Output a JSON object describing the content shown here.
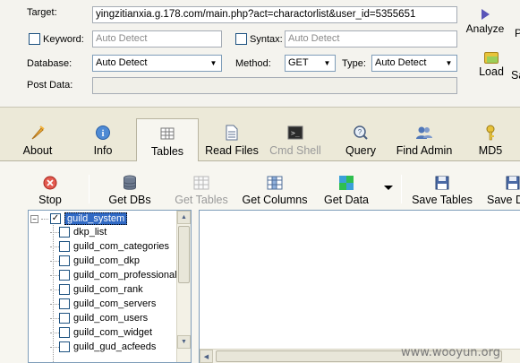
{
  "request": {
    "target_label": "Target:",
    "target_value": "yingzitianxia.g.178.com/main.php?act=charactorlist&user_id=5355651",
    "keyword_label": "Keyword:",
    "keyword_placeholder": "Auto Detect",
    "syntax_label": "Syntax:",
    "syntax_placeholder": "Auto Detect",
    "database_label": "Database:",
    "database_value": "Auto Detect",
    "method_label": "Method:",
    "method_value": "GET",
    "type_label": "Type:",
    "type_value": "Auto Detect",
    "postdata_label": "Post Data:",
    "analyze_label": "Analyze",
    "load_label": "Load",
    "save_partial_1": "P",
    "save_partial_2": "Sa"
  },
  "tabs": [
    {
      "label": "About",
      "icon": "feather-icon"
    },
    {
      "label": "Info",
      "icon": "info-icon"
    },
    {
      "label": "Tables",
      "icon": "tables-icon",
      "active": true
    },
    {
      "label": "Read Files",
      "icon": "file-icon"
    },
    {
      "label": "Cmd Shell",
      "icon": "terminal-icon",
      "disabled": true
    },
    {
      "label": "Query",
      "icon": "query-icon"
    },
    {
      "label": "Find Admin",
      "icon": "users-icon"
    },
    {
      "label": "MD5",
      "icon": "key-icon"
    }
  ],
  "toolbar": {
    "stop": "Stop",
    "get_dbs": "Get DBs",
    "get_tables": "Get Tables",
    "get_columns": "Get Columns",
    "get_data": "Get Data",
    "save_tables": "Save Tables",
    "save_partial": "Save D"
  },
  "tree": {
    "root": "guild_system",
    "items": [
      "dkp_list",
      "guild_com_categories",
      "guild_com_dkp",
      "guild_com_professional",
      "guild_com_rank",
      "guild_com_servers",
      "guild_com_users",
      "guild_com_widget",
      "guild_gud_acfeeds"
    ]
  },
  "watermark": "www.wooyun.org",
  "colors": {
    "background": "#ece9d8",
    "selection": "#316ac5",
    "field_border": "#7f9db9"
  }
}
